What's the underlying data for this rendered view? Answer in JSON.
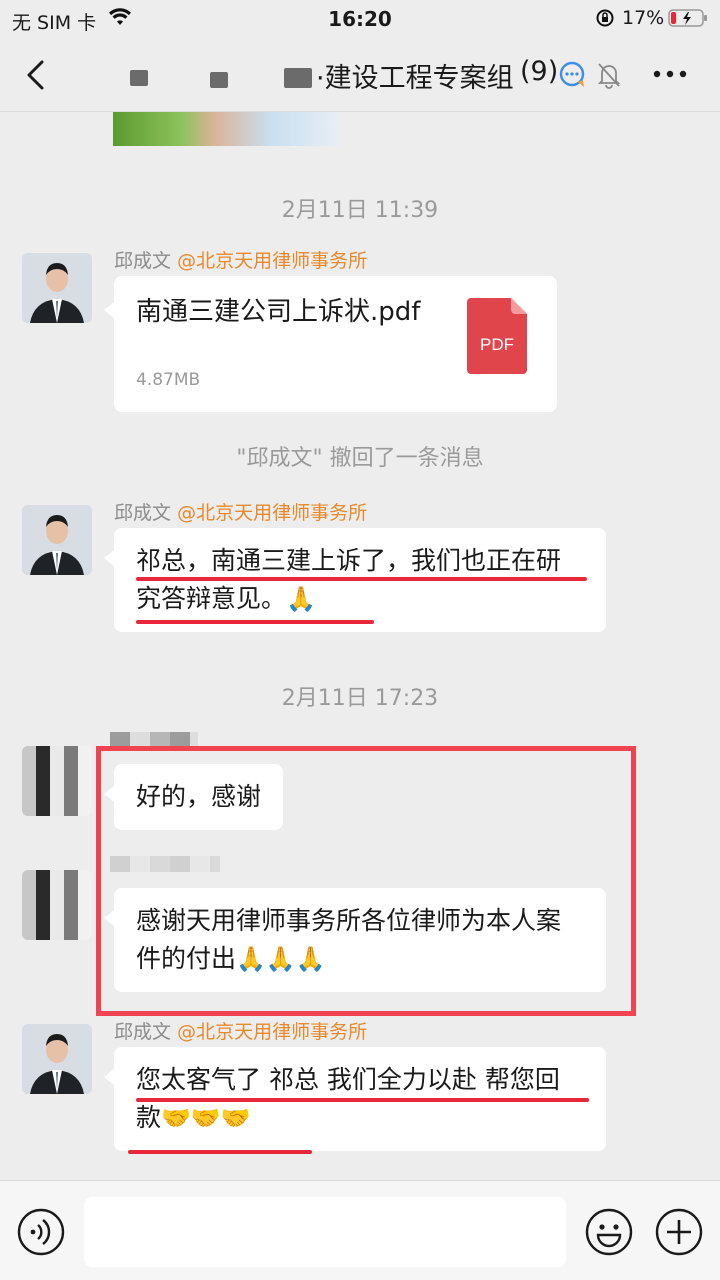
{
  "status": {
    "carrier": "无 SIM 卡",
    "time": "16:20",
    "battery_pct": "17%",
    "battery_level": 0.17
  },
  "header": {
    "title": "·建设工程专案组",
    "member_count": "(9)"
  },
  "messages": [
    {
      "type": "timestamp",
      "text": "2月11日 11:39"
    },
    {
      "type": "file",
      "sender": "邱成文",
      "org": "@北京天用律师事务所",
      "file_name": "南通三建公司上诉状.pdf",
      "file_size": "4.87MB",
      "file_badge": "PDF"
    },
    {
      "type": "system",
      "text": "\"邱成文\" 撤回了一条消息"
    },
    {
      "type": "text",
      "sender": "邱成文",
      "org": "@北京天用律师事务所",
      "text": "祁总，南通三建上诉了，我们也正在研究答辩意见。",
      "emoji": "🙏"
    },
    {
      "type": "timestamp",
      "text": "2月11日 17:23"
    },
    {
      "type": "text",
      "sender": "",
      "text": "好的，感谢"
    },
    {
      "type": "text",
      "sender": "",
      "text": "感谢天用律师事务所各位律师为本人案件的付出",
      "emoji": "🙏🙏🙏"
    },
    {
      "type": "text",
      "sender": "邱成文",
      "org": "@北京天用律师事务所",
      "text": "您太客气了 祁总 我们全力以赴 帮您回款",
      "emoji": "🤝🤝🤝"
    }
  ],
  "icons": {
    "back": "chevron-left-icon",
    "more": "more-icon",
    "mute": "mute-bell-icon",
    "voice": "voice-icon",
    "emoji": "emoji-icon",
    "plus": "plus-icon"
  },
  "colors": {
    "background": "#ededed",
    "org_tag": "#e8892b",
    "annotation_red": "#e8283a",
    "pdf_red": "#e0454b"
  }
}
